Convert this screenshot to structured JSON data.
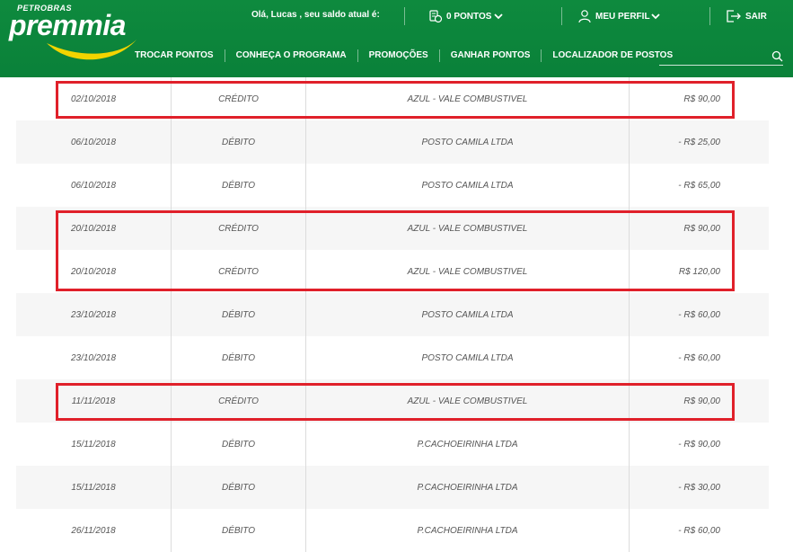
{
  "header": {
    "brand_top": "PETROBRAS",
    "brand_main": "premmia",
    "greeting": "Olá, Lucas , seu saldo atual é:",
    "points_label": "0 PONTOS",
    "profile_label": "MEU PERFIL",
    "logout_label": "SAIR",
    "colors": {
      "header_bg": "#0a8139",
      "swoosh": "#f2d400",
      "highlight": "#e0202a"
    }
  },
  "nav": {
    "items": [
      "TROCAR PONTOS",
      "CONHEÇA O PROGRAMA",
      "PROMOÇÕES",
      "GANHAR PONTOS",
      "LOCALIZADOR DE POSTOS"
    ],
    "search_placeholder": ""
  },
  "transactions": [
    {
      "date": "02/10/2018",
      "type": "CRÉDITO",
      "description": "AZUL - VALE COMBUSTIVEL",
      "value": "R$ 90,00",
      "highlighted": true
    },
    {
      "date": "06/10/2018",
      "type": "DÉBITO",
      "description": "POSTO CAMILA LTDA",
      "value": "- R$ 25,00",
      "highlighted": false
    },
    {
      "date": "06/10/2018",
      "type": "DÉBITO",
      "description": "POSTO CAMILA LTDA",
      "value": "- R$ 65,00",
      "highlighted": false
    },
    {
      "date": "20/10/2018",
      "type": "CRÉDITO",
      "description": "AZUL - VALE COMBUSTIVEL",
      "value": "R$ 90,00",
      "highlighted": true
    },
    {
      "date": "20/10/2018",
      "type": "CRÉDITO",
      "description": "AZUL - VALE COMBUSTIVEL",
      "value": "R$ 120,00",
      "highlighted": true
    },
    {
      "date": "23/10/2018",
      "type": "DÉBITO",
      "description": "POSTO CAMILA LTDA",
      "value": "- R$ 60,00",
      "highlighted": false
    },
    {
      "date": "23/10/2018",
      "type": "DÉBITO",
      "description": "POSTO CAMILA LTDA",
      "value": "- R$ 60,00",
      "highlighted": false
    },
    {
      "date": "11/11/2018",
      "type": "CRÉDITO",
      "description": "AZUL - VALE COMBUSTIVEL",
      "value": "R$ 90,00",
      "highlighted": true
    },
    {
      "date": "15/11/2018",
      "type": "DÉBITO",
      "description": "P.CACHOEIRINHA LTDA",
      "value": "- R$ 90,00",
      "highlighted": false
    },
    {
      "date": "15/11/2018",
      "type": "DÉBITO",
      "description": "P.CACHOEIRINHA LTDA",
      "value": "- R$ 30,00",
      "highlighted": false
    },
    {
      "date": "26/11/2018",
      "type": "DÉBITO",
      "description": "P.CACHOEIRINHA LTDA",
      "value": "- R$ 60,00",
      "highlighted": false
    }
  ]
}
